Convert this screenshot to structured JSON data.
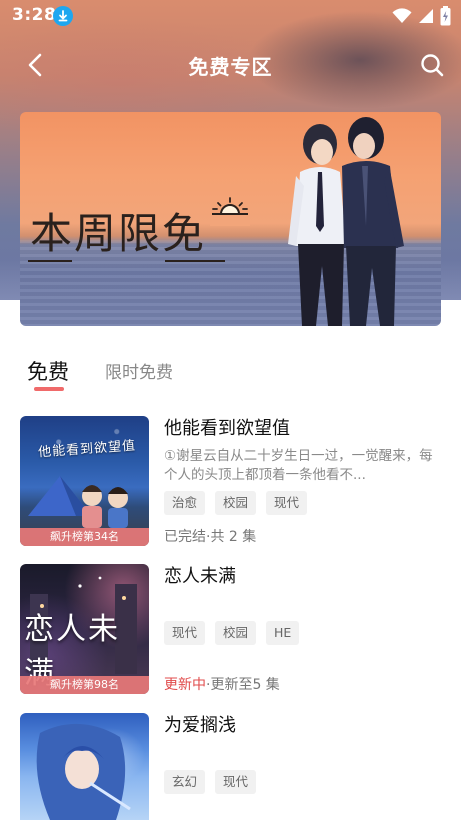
{
  "status_bar": {
    "time": "3:28"
  },
  "header": {
    "title": "免费专区"
  },
  "banner": {
    "text": "本周限免"
  },
  "tabs": [
    {
      "label": "免费",
      "active": true
    },
    {
      "label": "限时免费",
      "active": false
    }
  ],
  "items": [
    {
      "title": "他能看到欲望值",
      "desc": "①谢星云自从二十岁生日一过，一觉醒来，每个人的头顶上都顶着一条他看不...",
      "tags": [
        "治愈",
        "校园",
        "现代"
      ],
      "rank": "飙升榜第34名",
      "status": "已完结·共 2 集",
      "status_highlight": "",
      "cover_text": "他能看到欲望值"
    },
    {
      "title": "恋人未满",
      "desc": "",
      "tags": [
        "现代",
        "校园",
        "HE"
      ],
      "rank": "飙升榜第98名",
      "status": "·更新至5 集",
      "status_highlight": "更新中",
      "cover_text": "恋人未满"
    },
    {
      "title": "为爱搁浅",
      "desc": "",
      "tags": [
        "玄幻",
        "现代"
      ],
      "rank": "",
      "status": "",
      "status_highlight": "",
      "cover_text": ""
    }
  ],
  "colors": {
    "accent": "#f06a6a",
    "updating": "#e14b4b",
    "rank_badge": "#e87878"
  }
}
